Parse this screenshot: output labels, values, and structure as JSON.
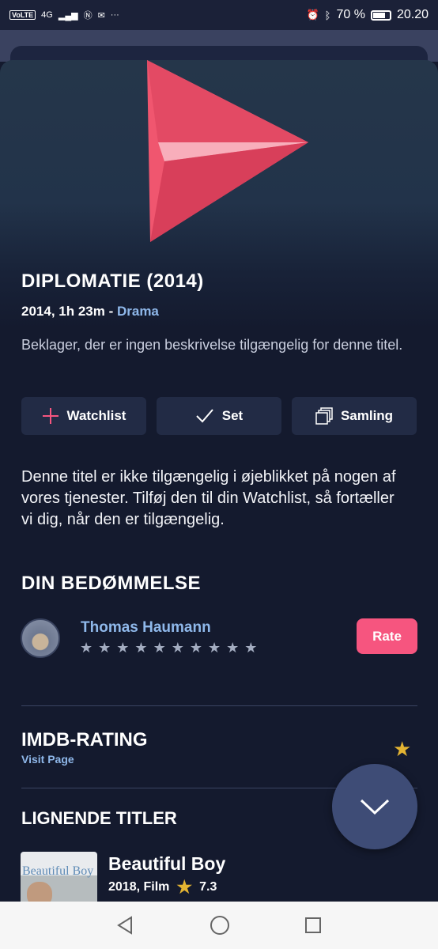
{
  "status_bar": {
    "left_badges": [
      "VoLTE",
      "4G"
    ],
    "battery": "70 %",
    "battery_level": 0.7,
    "time": "20.20",
    "more": "···"
  },
  "movie": {
    "title": "DIPLOMATIE (2014)",
    "meta_prefix": "2014, 1h 23m - ",
    "genre": "Drama",
    "description": "Beklager, der er ingen beskrivelse tilgængelig for denne titel."
  },
  "actions": {
    "watchlist": "Watchlist",
    "seen": "Set",
    "collection": "Samling"
  },
  "availability_notice": "Denne titel er ikke tilgængelig i øjeblikket på nogen af vores tjenester. Tilføj den til din Watchlist, så fortæller vi dig, når den er tilgængelig.",
  "rating_section": {
    "title": "DIN BEDØMMELSE",
    "user_name": "Thomas Haumann",
    "stars_total": 10,
    "rate_label": "Rate"
  },
  "imdb": {
    "title": "IMDB-RATING",
    "visit_label": "Visit Page"
  },
  "similar": {
    "title": "LIGNENDE TITLER",
    "items": [
      {
        "poster_text": "Beautiful Boy",
        "title": "Beautiful Boy",
        "meta": "2018, Film",
        "rating": "7.3"
      }
    ]
  },
  "colors": {
    "accent_pink": "#f6557f",
    "link_blue": "#8fb8ea",
    "star_gold": "#e4b432",
    "background": "#141a2e"
  },
  "icons": {
    "poster": "paper-plane-icon",
    "watchlist": "plus-icon",
    "seen": "check-icon",
    "collection": "stack-icon",
    "fab": "chevron-down-icon",
    "imdb": "star-icon",
    "nav": [
      "back-icon",
      "home-icon",
      "recents-icon"
    ]
  }
}
